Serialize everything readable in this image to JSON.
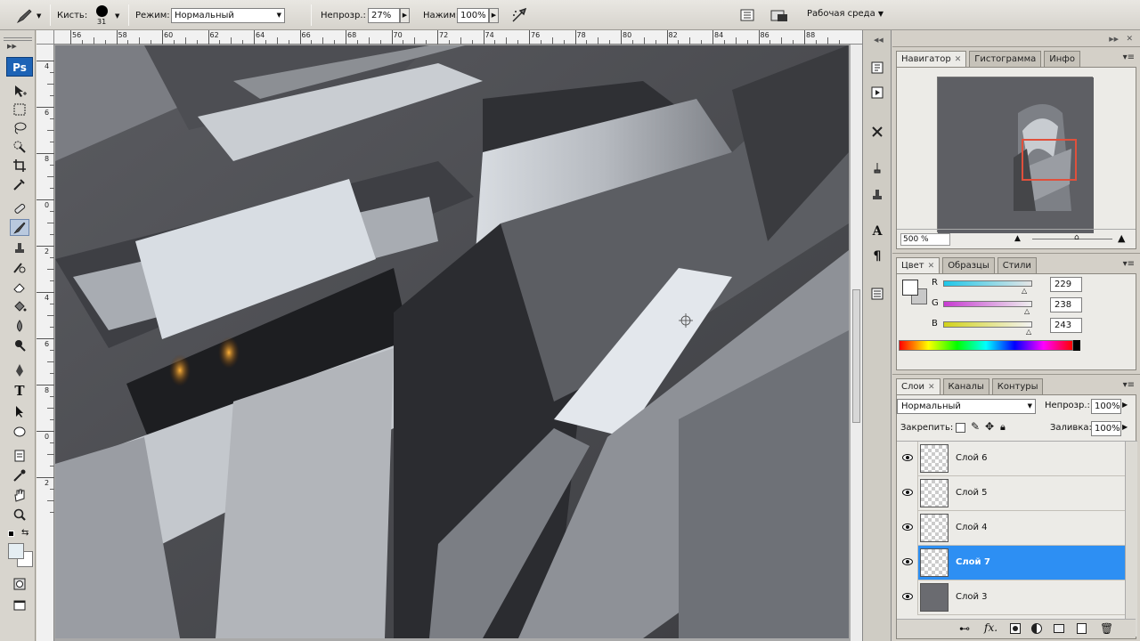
{
  "options_bar": {
    "brush_label": "Кисть:",
    "brush_size": "31",
    "mode_label": "Режим:",
    "mode_value": "Нормальный",
    "opacity_label": "Непрозр.:",
    "opacity_value": "27%",
    "flow_label": "Нажим:",
    "flow_value": "100%",
    "workspace_label": "Рабочая среда"
  },
  "ruler": {
    "top_ticks": [
      "56",
      "58",
      "60",
      "62",
      "64",
      "66",
      "68",
      "70",
      "72",
      "74",
      "76",
      "78",
      "80",
      "82",
      "84",
      "86",
      "88"
    ],
    "left_ticks": [
      "4",
      "6",
      "8",
      "0",
      "2",
      "4",
      "6",
      "8",
      "0",
      "2"
    ]
  },
  "navigator_panel": {
    "tabs": [
      "Навигатор",
      "Гистограмма",
      "Инфо"
    ],
    "zoom": "500 %"
  },
  "color_panel": {
    "tabs": [
      "Цвет",
      "Образцы",
      "Стили"
    ],
    "channels": [
      {
        "label": "R",
        "value": "229",
        "color": "#e5e5e5"
      },
      {
        "label": "G",
        "value": "238",
        "color": "#eeeeee"
      },
      {
        "label": "B",
        "value": "243",
        "color": "#f3f3f3"
      }
    ],
    "foreground_color": "#e5eef3",
    "background_color": "#ffffff"
  },
  "layers_panel": {
    "tabs": [
      "Слои",
      "Каналы",
      "Контуры"
    ],
    "blend_mode": "Нормальный",
    "opacity_label": "Непрозр.:",
    "opacity_value": "100%",
    "lock_label": "Закрепить:",
    "fill_label": "Заливка:",
    "fill_value": "100%",
    "layers": [
      {
        "name": "Слой 6",
        "selected": false
      },
      {
        "name": "Слой 5",
        "selected": false
      },
      {
        "name": "Слой 4",
        "selected": false
      },
      {
        "name": "Слой 7",
        "selected": true
      },
      {
        "name": "Слой 3",
        "selected": false
      }
    ],
    "footer_icons": [
      "link-icon",
      "fx-icon",
      "mask-icon",
      "adjustment-icon",
      "group-icon",
      "new-layer-icon",
      "trash-icon"
    ]
  },
  "colors": {
    "selection_blue": "#2d8ff3",
    "ps_logo": "#1d63b6",
    "navigator_frame": "#e0503c"
  }
}
